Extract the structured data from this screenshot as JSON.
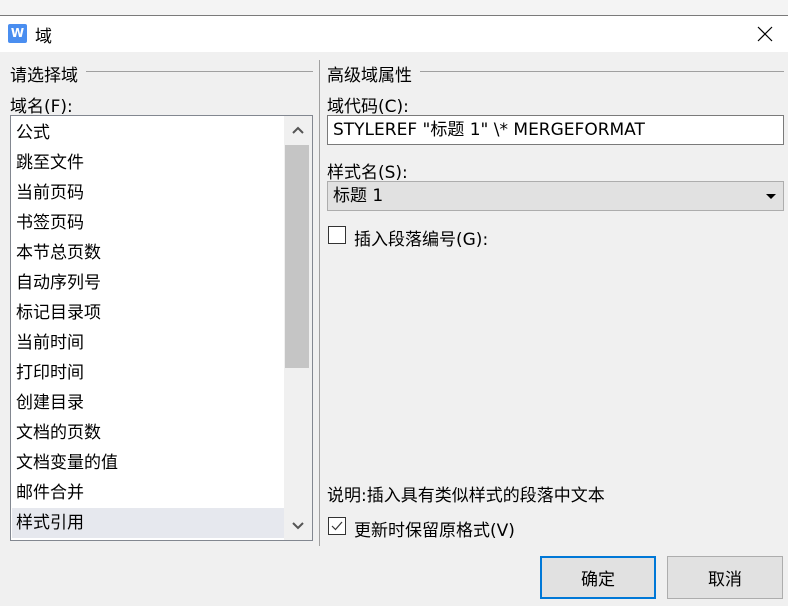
{
  "window": {
    "title": "域",
    "app_icon": "wps-writer-icon",
    "close_icon": "close-icon"
  },
  "left_group": {
    "title": "请选择域",
    "field_name_label": "域名(F):",
    "items": [
      {
        "label": "公式"
      },
      {
        "label": "跳至文件"
      },
      {
        "label": "当前页码"
      },
      {
        "label": "书签页码"
      },
      {
        "label": "本节总页数"
      },
      {
        "label": "自动序列号"
      },
      {
        "label": "标记目录项"
      },
      {
        "label": "当前时间"
      },
      {
        "label": "打印时间"
      },
      {
        "label": "创建目录"
      },
      {
        "label": "文档的页数"
      },
      {
        "label": "文档变量的值"
      },
      {
        "label": "邮件合并"
      },
      {
        "label": "样式引用"
      }
    ],
    "selected_index": 13
  },
  "right_group": {
    "title": "高级域属性",
    "field_code_label": "域代码(C):",
    "field_code_value": "STYLEREF \"标题 1\" \\* MERGEFORMAT",
    "style_name_label": "样式名(S):",
    "style_name_value": "标题 1",
    "insert_numbering_label": "插入段落编号(G):",
    "insert_numbering_checked": false,
    "description": "说明:插入具有类似样式的段落中文本",
    "preserve_format_label": "更新时保留原格式(V)",
    "preserve_format_checked": true
  },
  "buttons": {
    "ok": "确定",
    "cancel": "取消"
  },
  "colors": {
    "accent": "#0078d7",
    "app_icon": "#4a8ef0",
    "selection": "#e6e8ee"
  }
}
